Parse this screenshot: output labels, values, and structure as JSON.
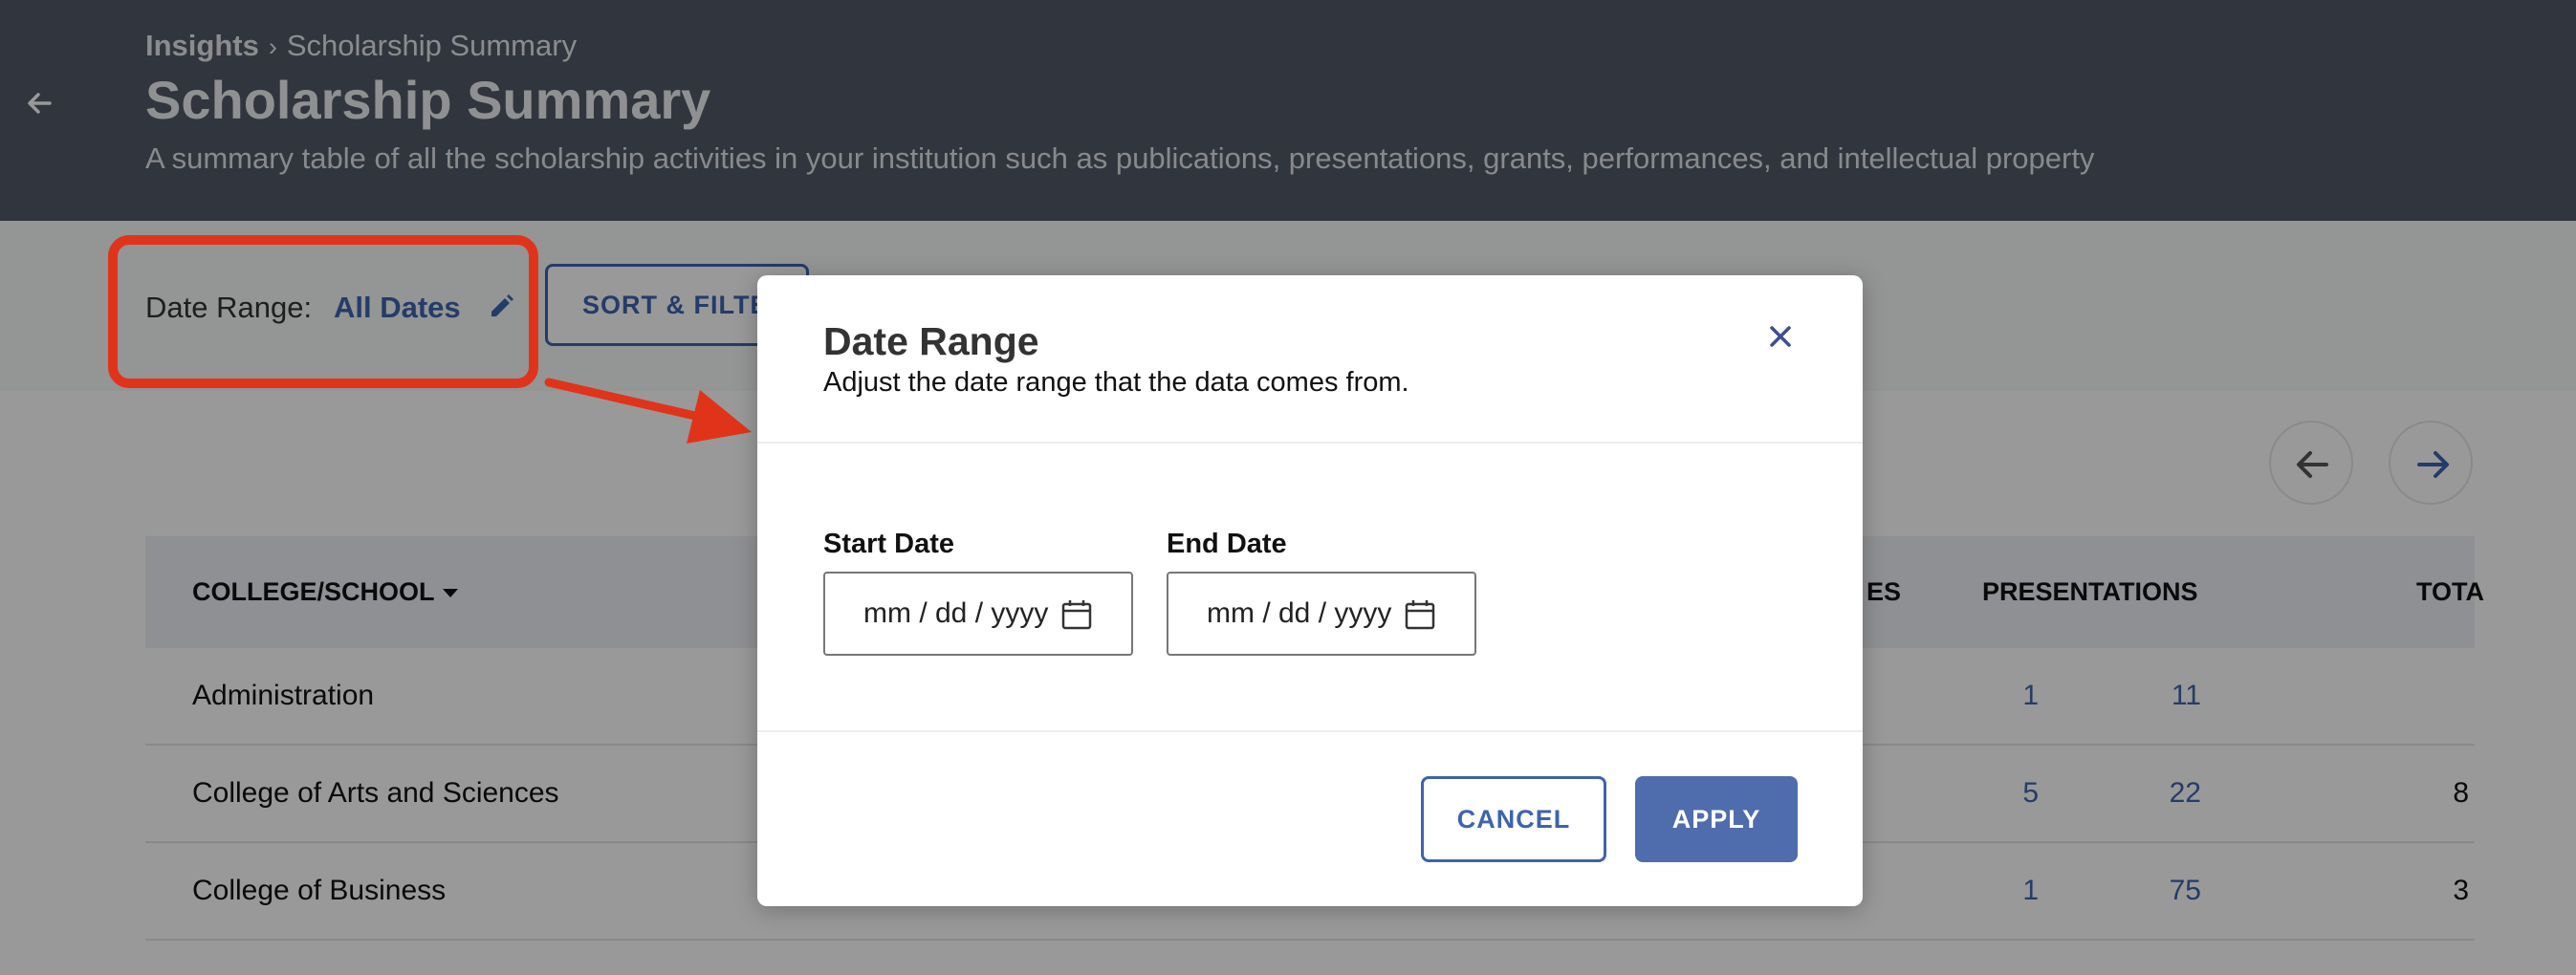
{
  "header": {
    "breadcrumb": {
      "root": "Insights",
      "separator": "›",
      "current": "Scholarship Summary"
    },
    "title": "Scholarship Summary",
    "subtitle": "A summary table of all the scholarship activities in your institution such as publications, presentations, grants, performances, and intellectual property",
    "back_icon": "arrow-left-icon"
  },
  "filters": {
    "date_range_label": "Date Range:",
    "date_range_value": "All Dates",
    "edit_icon": "pencil-icon",
    "sort_filter_label": "SORT & FILTER"
  },
  "table": {
    "columns": [
      "COLLEGE/SCHOOL",
      "ES",
      "PRESENTATIONS",
      "TOTA"
    ],
    "rows": [
      {
        "name": "Administration",
        "c3": "1",
        "presentations": "11",
        "total": ""
      },
      {
        "name": "College of Arts and Sciences",
        "c3": "5",
        "presentations": "22",
        "total": "8"
      },
      {
        "name": "College of Business",
        "c3": "1",
        "presentations": "75",
        "total": "3"
      }
    ]
  },
  "modal": {
    "title": "Date Range",
    "description": "Adjust the date range that the data comes from.",
    "start_label": "Start Date",
    "end_label": "End Date",
    "date_placeholder": "mm / dd / yyyy",
    "cancel_label": "CANCEL",
    "apply_label": "APPLY"
  },
  "colors": {
    "header_bg": "#525966",
    "accent": "#3d64ad",
    "highlight": "#e0341a",
    "apply_bg": "#4f6cad"
  }
}
